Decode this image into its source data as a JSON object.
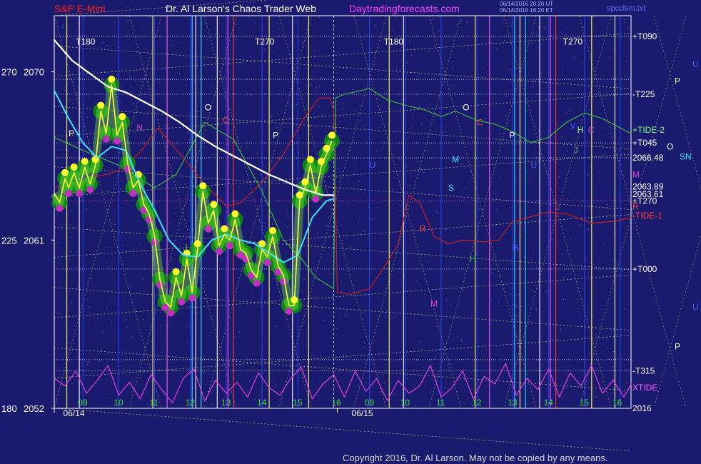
{
  "header": {
    "product": "S&P E-Mini",
    "site": "Dr. Al Larson's Chaos Trader Web",
    "url": "Daytradingforecasts.com",
    "time_1": "06/14/2016 20:20 UT",
    "time_2": "06/14/2016 16:20 ET",
    "file": "spcclsm.txt"
  },
  "footer": {
    "copyright": "Copyright 2016, Dr. Al Larson. May not be copied by any means."
  },
  "colors": {
    "background": "#1a1a6e",
    "price_line": "#ffff40",
    "price_glow": "#109010",
    "dots_magenta": "#c030c0",
    "dots_yellow": "#ffff30",
    "ma_slow": "#ffffff",
    "ma_fast": "#40e0ff",
    "tide_green": "#40c040",
    "tide_red": "#d02020",
    "xtide": "#e040e0"
  },
  "chart_data": {
    "type": "line",
    "title": "S&P E-Mini",
    "price_axis": {
      "range": [
        2052,
        2073
      ],
      "ticks": [
        2052,
        2061,
        2070
      ]
    },
    "square_axis": {
      "ticks": [
        "180",
        "225",
        "270"
      ]
    },
    "date_labels": [
      "06/14",
      "06/15"
    ],
    "hour_labels_day1": [
      "09",
      "10",
      "11",
      "12",
      "13",
      "14",
      "15",
      "16"
    ],
    "hour_labels_day2": [
      "09",
      "10",
      "11",
      "12",
      "13",
      "14",
      "15",
      "16"
    ],
    "time_range_hours": [
      8.2,
      24.3
    ],
    "right_labels": [
      {
        "text": "+T090",
        "price": 2071.9,
        "color": "#ffffff"
      },
      {
        "text": "-T225",
        "price": 2068.8,
        "color": "#ffffff"
      },
      {
        "text": "+TIDE-2",
        "price": 2066.9,
        "color": "#80ff80"
      },
      {
        "text": "+T045",
        "price": 2066.2,
        "color": "#ffffff"
      },
      {
        "text": "2066.48",
        "price": 2065.4,
        "color": "#ffffff"
      },
      {
        "text": "M",
        "price": 2064.5,
        "color": "#e040e0"
      },
      {
        "text": "2063.89",
        "price": 2063.85,
        "color": "#ffffff"
      },
      {
        "text": "2063.61",
        "price": 2063.45,
        "color": "#ffffff"
      },
      {
        "text": "+T270",
        "price": 2063.1,
        "color": "#ffffff"
      },
      {
        "text": "R",
        "price": 2062.8,
        "color": "#ff4040"
      },
      {
        "text": "-TIDE-1",
        "price": 2062.3,
        "color": "#ff4040"
      },
      {
        "text": "+T000",
        "price": 2059.45,
        "color": "#ffffff"
      },
      {
        "text": "-T315",
        "price": 2054.0,
        "color": "#ffffff"
      },
      {
        "text": "XTIDE",
        "price": 2053.1,
        "color": "#ff60ff"
      },
      {
        "text": "2016",
        "price": 2052.0,
        "color": "#ffffff"
      }
    ],
    "far_right_letters": [
      {
        "text": "U",
        "price": 2070.4,
        "color": "#4060ff"
      },
      {
        "text": "P",
        "price": 2069.5,
        "color": "#ffffff"
      },
      {
        "text": "O",
        "price": 2066.0,
        "color": "#ffffff"
      },
      {
        "text": "SN",
        "price": 2065.45,
        "color": "#40e0ff"
      },
      {
        "text": "U",
        "price": 2057.4,
        "color": "#4060ff"
      },
      {
        "text": "P",
        "price": 2055.3,
        "color": "#ffffff"
      }
    ],
    "grid_tags": [
      {
        "text": "T180",
        "t": 8.8,
        "price": 2071.6,
        "color": "#ffffff"
      },
      {
        "text": "T270",
        "t": 13.8,
        "price": 2071.6,
        "color": "#ffffff"
      },
      {
        "text": "T180",
        "t": 17.4,
        "price": 2071.6,
        "color": "#ffffff"
      },
      {
        "text": "T270",
        "t": 22.4,
        "price": 2071.6,
        "color": "#ffffff"
      }
    ],
    "letters": [
      {
        "text": "P",
        "t": 8.6,
        "price": 2066.7,
        "color": "#ffffff"
      },
      {
        "text": "O",
        "t": 12.4,
        "price": 2068.1,
        "color": "#ffffff"
      },
      {
        "text": "C",
        "t": 12.9,
        "price": 2067.4,
        "color": "#ff4040"
      },
      {
        "text": "P",
        "t": 14.3,
        "price": 2066.6,
        "color": "#ffffff"
      },
      {
        "text": "O",
        "t": 19.6,
        "price": 2068.1,
        "color": "#ffffff"
      },
      {
        "text": "C",
        "t": 20.0,
        "price": 2067.3,
        "color": "#ff4040"
      },
      {
        "text": "P",
        "t": 20.9,
        "price": 2066.6,
        "color": "#ffffff"
      },
      {
        "text": "V",
        "t": 22.6,
        "price": 2067.1,
        "color": "#4060ff"
      },
      {
        "text": "H",
        "t": 22.8,
        "price": 2066.9,
        "color": "#80ff80"
      },
      {
        "text": "C",
        "t": 23.1,
        "price": 2066.9,
        "color": "#e040e0"
      },
      {
        "text": "J",
        "t": 22.7,
        "price": 2065.8,
        "color": "#40c040"
      },
      {
        "text": "M",
        "t": 19.3,
        "price": 2065.3,
        "color": "#40e0ff"
      },
      {
        "text": "S",
        "t": 19.2,
        "price": 2063.8,
        "color": "#40e0ff"
      },
      {
        "text": "N",
        "t": 10.5,
        "price": 2067.0,
        "color": "#e040e0"
      },
      {
        "text": "U",
        "t": 17.0,
        "price": 2065.0,
        "color": "#4060ff"
      },
      {
        "text": "U",
        "t": 21.5,
        "price": 2065.0,
        "color": "#4060ff"
      },
      {
        "text": "R",
        "t": 18.4,
        "price": 2061.6,
        "color": "#ff4040"
      },
      {
        "text": "J",
        "t": 11.8,
        "price": 2060.6,
        "color": "#40c040"
      },
      {
        "text": "H",
        "t": 19.8,
        "price": 2060.0,
        "color": "#40c040"
      },
      {
        "text": "M",
        "t": 18.7,
        "price": 2057.6,
        "color": "#e040e0"
      },
      {
        "text": "B",
        "t": 21.0,
        "price": 2060.6,
        "color": "#4060ff"
      }
    ],
    "vertical_lines": [
      {
        "t": 8.55,
        "color": "#ffff60"
      },
      {
        "t": 8.9,
        "color": "#ffffff"
      },
      {
        "t": 10.95,
        "color": "#ffff60"
      },
      {
        "t": 11.35,
        "color": "#ff60ff"
      },
      {
        "t": 12.05,
        "color": "#40e0ff"
      },
      {
        "t": 12.15,
        "color": "#ffffff"
      },
      {
        "t": 12.3,
        "color": "#40e0ff"
      },
      {
        "t": 12.75,
        "color": "#ffffff"
      },
      {
        "t": 13.05,
        "color": "#ff60ff"
      },
      {
        "t": 13.2,
        "color": "#ff4040"
      },
      {
        "t": 14.2,
        "color": "#ffff60"
      },
      {
        "t": 14.85,
        "color": "#ffffff"
      },
      {
        "t": 15.3,
        "color": "#ffff60"
      },
      {
        "t": 17.55,
        "color": "#ffff60"
      },
      {
        "t": 17.95,
        "color": "#ffffff"
      },
      {
        "t": 19.95,
        "color": "#ffff60"
      },
      {
        "t": 20.35,
        "color": "#ff60ff"
      },
      {
        "t": 21.05,
        "color": "#40e0ff"
      },
      {
        "t": 21.2,
        "color": "#ffffff"
      },
      {
        "t": 21.35,
        "color": "#40e0ff"
      },
      {
        "t": 21.75,
        "color": "#ffffff"
      },
      {
        "t": 22.05,
        "color": "#ff60ff"
      },
      {
        "t": 22.2,
        "color": "#ff4040"
      },
      {
        "t": 23.2,
        "color": "#ffff60"
      },
      {
        "t": 23.85,
        "color": "#ffffff"
      }
    ],
    "horizontal_levels": [
      {
        "price": 2071.9,
        "color": "#ffffff"
      },
      {
        "price": 2069.6,
        "color": "#ffffff"
      },
      {
        "price": 2068.8,
        "color": "#ffffff"
      },
      {
        "price": 2066.2,
        "color": "#ffffff"
      },
      {
        "price": 2065.4,
        "color": "#ffffff"
      },
      {
        "price": 2063.1,
        "color": "#ff60ff"
      },
      {
        "price": 2059.45,
        "color": "#ffffff"
      },
      {
        "price": 2054.0,
        "color": "#ffffff"
      },
      {
        "price": 2054.6,
        "color": "#ffffff"
      }
    ],
    "series": [
      {
        "key": "price",
        "x": [
          8.2,
          8.35,
          8.5,
          8.6,
          8.75,
          8.9,
          9.05,
          9.2,
          9.35,
          9.5,
          9.65,
          9.8,
          9.95,
          10.1,
          10.25,
          10.4,
          10.55,
          10.7,
          10.85,
          11.0,
          11.15,
          11.3,
          11.45,
          11.6,
          11.75,
          11.9,
          12.05,
          12.2,
          12.35,
          12.5,
          12.65,
          12.8,
          12.95,
          13.1,
          13.25,
          13.4,
          13.55,
          13.7,
          13.85,
          14.0,
          14.15,
          14.3,
          14.45,
          14.6,
          14.75,
          14.9,
          15.05,
          15.2,
          15.35,
          15.5,
          15.65,
          15.8,
          15.95
        ],
        "values": [
          2063.5,
          2063.0,
          2064.3,
          2063.8,
          2064.6,
          2063.8,
          2064.9,
          2064.0,
          2065.0,
          2067.9,
          2066.7,
          2069.3,
          2066.6,
          2067.3,
          2065.1,
          2063.8,
          2064.2,
          2062.9,
          2062.4,
          2061.2,
          2058.9,
          2057.7,
          2057.4,
          2059.0,
          2058.0,
          2060.0,
          2058.2,
          2060.5,
          2063.6,
          2061.9,
          2062.6,
          2060.7,
          2061.3,
          2061.0,
          2062.1,
          2060.5,
          2060.3,
          2059.4,
          2059.0,
          2060.5,
          2060.1,
          2061.2,
          2059.6,
          2059.1,
          2057.5,
          2057.5,
          2063.1,
          2063.8,
          2065.0,
          2063.5,
          2064.9,
          2065.6,
          2066.3
        ]
      },
      {
        "key": "ma_slow",
        "x": [
          8.2,
          8.7,
          9.2,
          9.7,
          10.2,
          10.7,
          11.2,
          11.7,
          12.2,
          12.7,
          13.2,
          13.7,
          14.2,
          14.7,
          15.2,
          15.7,
          16.0
        ],
        "values": [
          2071.7,
          2070.6,
          2069.9,
          2069.2,
          2068.9,
          2068.4,
          2067.9,
          2067.3,
          2066.6,
          2066.0,
          2065.5,
          2065.0,
          2064.5,
          2064.1,
          2063.7,
          2063.4,
          2063.4
        ]
      },
      {
        "key": "ma_fast",
        "x": [
          8.2,
          8.6,
          9.0,
          9.4,
          9.8,
          10.2,
          10.6,
          11.0,
          11.4,
          11.8,
          12.2,
          12.6,
          13.0,
          13.4,
          13.8,
          14.2,
          14.6,
          15.0,
          15.4,
          15.8,
          16.0
        ],
        "values": [
          2069.0,
          2067.5,
          2066.2,
          2065.4,
          2066.0,
          2065.8,
          2064.0,
          2062.6,
          2061.0,
          2060.2,
          2060.1,
          2061.0,
          2061.3,
          2061.0,
          2060.8,
          2060.3,
          2059.8,
          2060.2,
          2062.2,
          2063.1,
          2063.2
        ]
      },
      {
        "key": "tide_green",
        "x": [
          8.2,
          9.0,
          10.0,
          11.0,
          11.6,
          12.4,
          13.2,
          14.0,
          14.6,
          15.1,
          15.5,
          16.0,
          16.05,
          16.3,
          17.0,
          17.5,
          18.0,
          18.5,
          19.0,
          19.4,
          20.0,
          20.5,
          21.0,
          21.5,
          22.0,
          22.5,
          23.0,
          23.5,
          24.0,
          24.3
        ],
        "values": [
          2066.5,
          2065.8,
          2065.0,
          2063.8,
          2064.5,
          2067.3,
          2066.4,
          2063.6,
          2061.0,
          2060.0,
          2059.0,
          2058.4,
          2068.6,
          2068.8,
          2069.1,
          2068.5,
          2068.2,
          2068.0,
          2067.6,
          2067.9,
          2067.4,
          2067.2,
          2066.8,
          2066.2,
          2066.5,
          2067.3,
          2067.8,
          2067.5,
          2067.0,
          2066.7
        ]
      },
      {
        "key": "tide_red",
        "x": [
          8.2,
          9.0,
          10.0,
          10.6,
          11.1,
          11.8,
          12.4,
          13.0,
          13.4,
          14.0,
          14.6,
          15.2,
          15.6,
          15.9,
          16.0,
          16.1,
          16.5,
          17.0,
          17.5,
          17.8,
          18.1,
          18.4,
          18.8,
          19.2,
          19.6,
          20.2,
          20.6,
          21.0,
          21.6,
          22.0,
          22.5,
          23.2,
          23.8,
          24.3
        ],
        "values": [
          2063.8,
          2064.2,
          2064.7,
          2065.7,
          2067.0,
          2065.4,
          2064.0,
          2062.8,
          2063.0,
          2064.1,
          2065.6,
          2067.6,
          2068.6,
          2068.6,
          2068.0,
          2058.2,
          2058.1,
          2058.4,
          2059.8,
          2060.8,
          2063.4,
          2063.0,
          2061.2,
          2060.8,
          2061.0,
          2060.9,
          2061.0,
          2062.0,
          2062.3,
          2062.5,
          2062.4,
          2061.9,
          2062.0,
          2062.2
        ]
      },
      {
        "key": "xtide",
        "x": [
          8.2,
          8.5,
          8.8,
          9.1,
          9.4,
          9.7,
          10.0,
          10.3,
          10.6,
          10.9,
          11.2,
          11.5,
          11.8,
          12.1,
          12.4,
          12.7,
          13.0,
          13.3,
          13.6,
          13.9,
          14.2,
          14.5,
          14.8,
          15.1,
          15.4,
          15.7,
          16.0,
          16.3,
          16.6,
          16.9,
          17.2,
          17.5,
          17.8,
          18.1,
          18.4,
          18.7,
          19.0,
          19.3,
          19.6,
          19.9,
          20.2,
          20.5,
          20.8,
          21.1,
          21.4,
          21.7,
          22.0,
          22.3,
          22.6,
          22.9,
          23.2,
          23.5,
          23.8,
          24.1,
          24.3
        ],
        "values": [
          2053.6,
          2053.2,
          2054.0,
          2052.8,
          2053.5,
          2054.3,
          2052.7,
          2053.4,
          2052.5,
          2053.8,
          2053.0,
          2052.3,
          2053.6,
          2054.1,
          2052.4,
          2053.5,
          2052.8,
          2053.4,
          2052.6,
          2053.9,
          2053.1,
          2052.7,
          2053.6,
          2054.2,
          2052.5,
          2053.3,
          2053.8,
          2052.6,
          2054.0,
          2052.9,
          2053.6,
          2052.4,
          2053.5,
          2052.8,
          2053.2,
          2054.3,
          2052.6,
          2053.1,
          2054.0,
          2052.5,
          2053.7,
          2053.3,
          2054.4,
          2052.7,
          2053.6,
          2053.0,
          2054.1,
          2052.6,
          2053.9,
          2053.2,
          2054.3,
          2052.8,
          2053.5,
          2052.6,
          2053.3
        ]
      }
    ]
  }
}
